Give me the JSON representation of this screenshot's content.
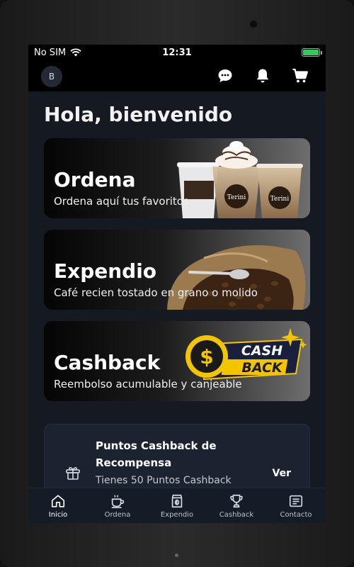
{
  "status_bar": {
    "carrier": "No SIM",
    "time": "12:31"
  },
  "header": {
    "avatar_initial": "B",
    "icons": [
      "chat-icon",
      "bell-icon",
      "cart-icon"
    ]
  },
  "greeting": "Hola, bienvenido",
  "cards": [
    {
      "title": "Ordena",
      "subtitle": "Ordena aquí tus favoritos",
      "cup_brand": "Terini"
    },
    {
      "title": "Expendio",
      "subtitle": "Café recien tostado en grano o molido"
    },
    {
      "title": "Cashback",
      "subtitle": "Reembolso acumulable y canjeable",
      "badge_top": "CASH",
      "badge_bottom": "BACK"
    }
  ],
  "points": {
    "title": "Puntos Cashback de Recompensa",
    "subtitle": "Tienes 50 Puntos Cashback",
    "action": "Ver"
  },
  "nav": [
    {
      "label": "Inicio",
      "icon": "home-icon",
      "active": true
    },
    {
      "label": "Ordena",
      "icon": "coffee-cup-icon",
      "active": false
    },
    {
      "label": "Expendio",
      "icon": "coffee-bag-icon",
      "active": false
    },
    {
      "label": "Cashback",
      "icon": "trophy-icon",
      "active": false
    },
    {
      "label": "Contacto",
      "icon": "contact-card-icon",
      "active": false
    }
  ],
  "colors": {
    "screen_bg": "#141922",
    "battery": "#35c759",
    "badge_yellow": "#f5c400"
  }
}
